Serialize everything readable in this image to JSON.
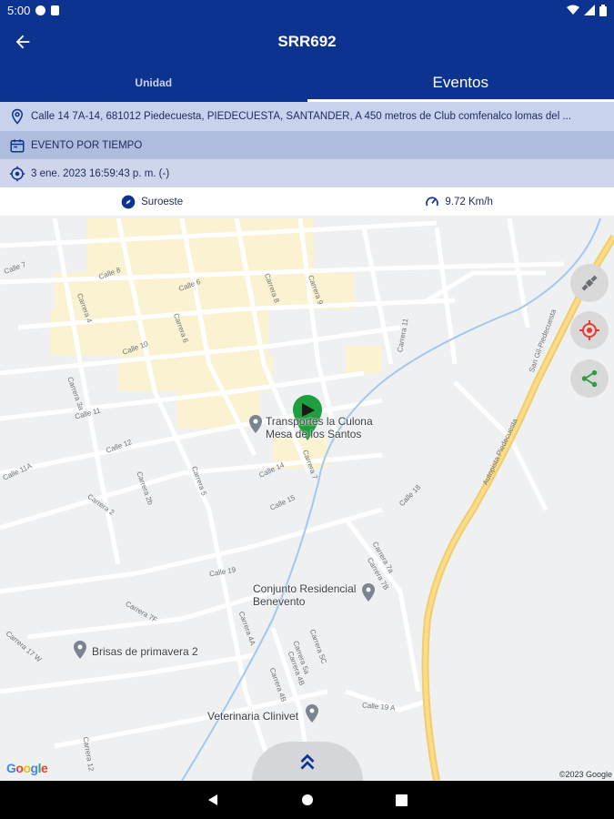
{
  "status_bar": {
    "time": "5:00"
  },
  "appbar": {
    "title": "SRR692"
  },
  "tabs": [
    {
      "label": "Unidad",
      "active": false
    },
    {
      "label": "Eventos",
      "active": true
    }
  ],
  "info": {
    "address": "Calle 14 7A-14, 681012 Piedecuesta, PIEDECUESTA, SANTANDER,  A 450 metros de Club comfenalco lomas del ...",
    "event_type": "EVENTO POR TIEMPO",
    "datetime": "3 ene. 2023 16:59:43 p. m. (-)",
    "direction": "Suroeste",
    "speed": "9.72 Km/h"
  },
  "map": {
    "pins": [
      {
        "label": "Transportes la Culona\nMesa de los Santos"
      },
      {
        "label": "Conjunto Residencial\nBenevento"
      },
      {
        "label": "Brisas de primavera 2"
      },
      {
        "label": "Veterinaria Clinivet"
      }
    ],
    "streets": [
      "Calle 7",
      "Calle 8",
      "Calle 6",
      "Carrera 4",
      "Carrera 6",
      "Carrera 8",
      "Carrera 9",
      "Carrera 11",
      "Calle 10",
      "Carrera 3a",
      "Calle 11",
      "Calle 12",
      "Calle 11A",
      "Carrera 2b",
      "Carrera 5",
      "Calle 14",
      "Calle 15",
      "Carrera 7",
      "Calle 18",
      "Carrera 2",
      "Calle 19",
      "Carrera 7F",
      "Carrera 4A",
      "Carrera 7a",
      "Carrera 7B",
      "Carrera 17 W",
      "Carrera 5C",
      "Carrera 5a",
      "Carrera 4B",
      "Carrera 4B",
      "Calle 19 A",
      "Carrera 12",
      "San Gil-Piedecuesta",
      "Autopista Piedecuesta"
    ],
    "google_logo": "Google",
    "copyright": "©2023 Google"
  },
  "colors": {
    "primary": "#0d3391",
    "marker": "#1e9e3c",
    "road_major": "#f5cc66",
    "urban_area": "#fbf2d2"
  },
  "icons": {
    "back": "arrow-left-icon",
    "address": "location-pin-icon",
    "event": "calendar-icon",
    "datetime": "location-target-icon",
    "direction": "compass-icon",
    "speed": "speedometer-icon",
    "fab_layers": "satellite-icon",
    "fab_locate": "gps-locate-icon",
    "fab_share": "share-icon",
    "expand": "double-chevron-up-icon"
  }
}
